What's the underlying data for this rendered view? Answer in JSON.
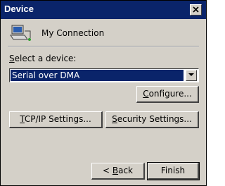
{
  "window": {
    "title": "Device"
  },
  "connection": {
    "name": "My Connection",
    "icon": "computer-connection-icon"
  },
  "device": {
    "label": "Select a device:",
    "selected": "Serial over DMA"
  },
  "buttons": {
    "configure": "Configure...",
    "tcpip": "TCP/IP Settings...",
    "security": "Security Settings...",
    "back": "< Back",
    "finish": "Finish"
  }
}
